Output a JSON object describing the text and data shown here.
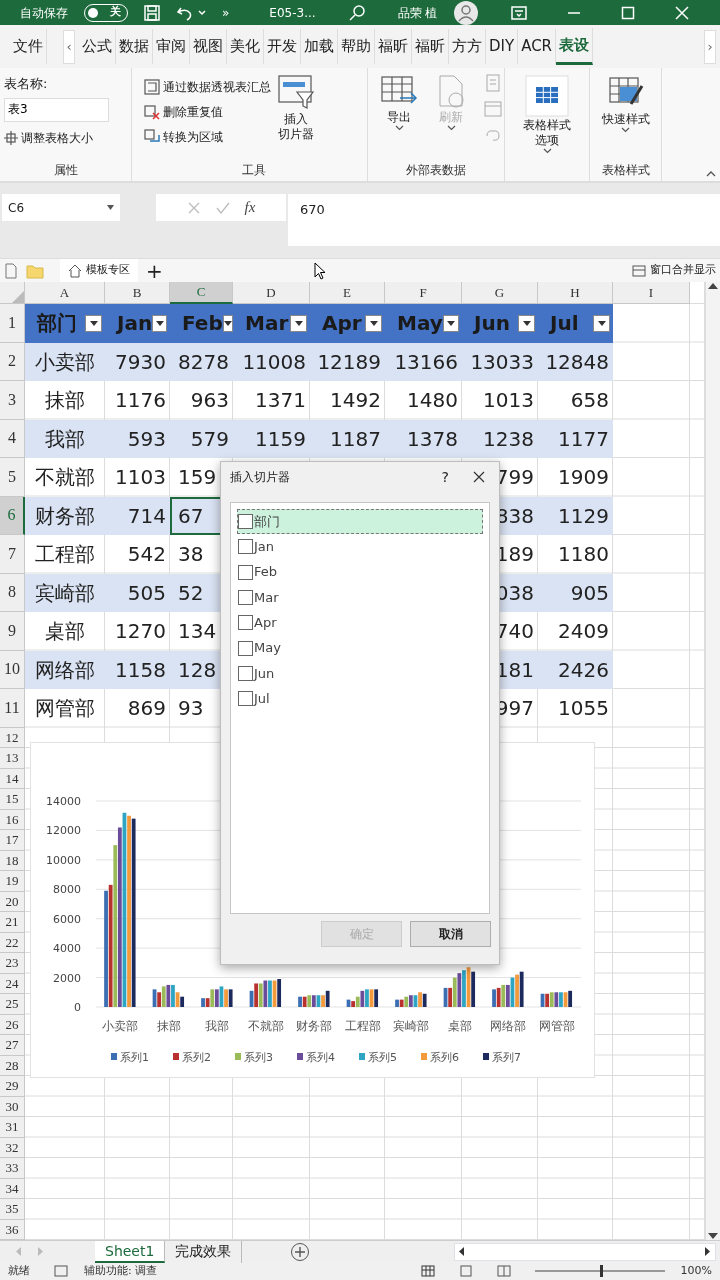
{
  "title_bar": {
    "autosave_label": "自动保存",
    "autosave_toggle": {
      "label": "关",
      "on": false
    },
    "overflow": "»",
    "file_name": "E05-3...",
    "user_name": "品荣 植"
  },
  "ribbon_tabs": {
    "scroll_left": "‹",
    "scroll_right": "›",
    "items": [
      {
        "label": "文件",
        "selected": false
      },
      {
        "label": "公式",
        "selected": false
      },
      {
        "label": "数据",
        "selected": false
      },
      {
        "label": "审阅",
        "selected": false
      },
      {
        "label": "视图",
        "selected": false
      },
      {
        "label": "美化",
        "selected": false
      },
      {
        "label": "开发",
        "selected": false
      },
      {
        "label": "加载",
        "selected": false
      },
      {
        "label": "帮助",
        "selected": false
      },
      {
        "label": "福昕",
        "selected": false
      },
      {
        "label": "福昕",
        "selected": false
      },
      {
        "label": "方方",
        "selected": false
      },
      {
        "label": "DIY",
        "selected": false
      },
      {
        "label": "ACR",
        "selected": false
      },
      {
        "label": "表设",
        "selected": true
      }
    ]
  },
  "ribbon_groups": [
    {
      "kind": "properties",
      "label": "属性",
      "name_label": "表名称:",
      "name_value": "表3",
      "resize_button": "调整表格大小"
    },
    {
      "kind": "tools",
      "label": "工具",
      "actions": [
        "通过数据透视表汇总",
        "删除重复值",
        "转换为区域"
      ],
      "slicer_button": [
        "插入",
        "切片器"
      ]
    },
    {
      "kind": "external",
      "label": "外部表数据",
      "export_button": "导出",
      "refresh_button": {
        "label": "刷新",
        "disabled": true
      }
    },
    {
      "kind": "options",
      "button": [
        "表格样式",
        "选项"
      ]
    },
    {
      "kind": "styles",
      "label": "表格样式",
      "button": "快速样式"
    }
  ],
  "formula_bar": {
    "name_box": "C6",
    "fx_label": "fx",
    "formula": "670"
  },
  "workbook_bar": {
    "home_tab": "模板专区",
    "add": "+",
    "merge_windows": "窗口合并显示"
  },
  "sheet": {
    "columns": [
      {
        "label": "A",
        "selected": false
      },
      {
        "label": "B",
        "selected": false
      },
      {
        "label": "C",
        "selected": true
      },
      {
        "label": "D",
        "selected": false
      },
      {
        "label": "E",
        "selected": false
      },
      {
        "label": "F",
        "selected": false
      },
      {
        "label": "G",
        "selected": false
      },
      {
        "label": "H",
        "selected": false
      },
      {
        "label": "I",
        "selected": false
      }
    ],
    "rows": [
      {
        "number": "1",
        "kind": "table_header",
        "selected": false,
        "cells": [
          "部门",
          "Jan",
          "Feb",
          "Mar",
          "Apr",
          "May",
          "Jun",
          "Jul"
        ]
      },
      {
        "number": "2",
        "kind": "table_row",
        "selected": false,
        "cells": [
          "小卖部",
          "7930",
          "8278",
          "11008",
          "12189",
          "13166",
          "13033",
          "12848"
        ]
      },
      {
        "number": "3",
        "kind": "table_row",
        "selected": false,
        "cells": [
          "抹部",
          "1176",
          "963",
          "1371",
          "1492",
          "1480",
          "1013",
          "658"
        ]
      },
      {
        "number": "4",
        "kind": "table_row",
        "selected": false,
        "cells": [
          "我部",
          "593",
          "579",
          "1159",
          "1187",
          "1378",
          "1238",
          "1177"
        ]
      },
      {
        "number": "5",
        "kind": "table_row",
        "selected": false,
        "cells": [
          "不就部",
          "1103",
          "159"
        ],
        "right_cells": [
          "799",
          "1909"
        ]
      },
      {
        "number": "6",
        "kind": "table_row",
        "selected": true,
        "cells": [
          "财务部",
          "714",
          "67"
        ],
        "right_cells": [
          "838",
          "1129"
        ]
      },
      {
        "number": "7",
        "kind": "table_row",
        "selected": false,
        "cells": [
          "工程部",
          "542",
          "38"
        ],
        "right_cells": [
          "189",
          "1180"
        ]
      },
      {
        "number": "8",
        "kind": "table_row",
        "selected": false,
        "cells": [
          "宾崎部",
          "505",
          "52"
        ],
        "right_cells": [
          "038",
          "905"
        ]
      },
      {
        "number": "9",
        "kind": "table_row",
        "selected": false,
        "cells": [
          "桌部",
          "1270",
          "134"
        ],
        "right_cells": [
          "740",
          "2409"
        ]
      },
      {
        "number": "10",
        "kind": "table_row",
        "selected": false,
        "cells": [
          "网络部",
          "1158",
          "128"
        ],
        "right_cells": [
          "181",
          "2426"
        ]
      },
      {
        "number": "11",
        "kind": "table_row",
        "selected": false,
        "cells": [
          "网管部",
          "869",
          "93"
        ],
        "right_cells": [
          "997",
          "1055"
        ]
      },
      {
        "number": "12",
        "kind": "blank",
        "selected": false
      },
      {
        "number": "13",
        "kind": "blank",
        "selected": false
      },
      {
        "number": "14",
        "kind": "blank",
        "selected": false
      },
      {
        "number": "15",
        "kind": "blank",
        "selected": false
      },
      {
        "number": "16",
        "kind": "blank",
        "selected": false
      },
      {
        "number": "17",
        "kind": "blank",
        "selected": false
      },
      {
        "number": "18",
        "kind": "blank",
        "selected": false
      },
      {
        "number": "19",
        "kind": "blank",
        "selected": false
      },
      {
        "number": "20",
        "kind": "blank",
        "selected": false
      },
      {
        "number": "21",
        "kind": "blank",
        "selected": false
      },
      {
        "number": "22",
        "kind": "blank",
        "selected": false
      },
      {
        "number": "23",
        "kind": "blank",
        "selected": false
      },
      {
        "number": "24",
        "kind": "blank",
        "selected": false
      },
      {
        "number": "25",
        "kind": "blank",
        "selected": false
      },
      {
        "number": "26",
        "kind": "blank",
        "selected": false
      },
      {
        "number": "27",
        "kind": "blank",
        "selected": false
      },
      {
        "number": "28",
        "kind": "blank",
        "selected": false
      },
      {
        "number": "29",
        "kind": "blank",
        "selected": false
      },
      {
        "number": "30",
        "kind": "blank",
        "selected": false
      },
      {
        "number": "31",
        "kind": "blank",
        "selected": false
      },
      {
        "number": "32",
        "kind": "blank",
        "selected": false
      },
      {
        "number": "33",
        "kind": "blank",
        "selected": false
      },
      {
        "number": "34",
        "kind": "blank",
        "selected": false
      },
      {
        "number": "35",
        "kind": "blank",
        "selected": false
      },
      {
        "number": "36",
        "kind": "blank",
        "selected": false
      }
    ]
  },
  "chart": {
    "chart_data": {
      "type": "bar",
      "categories": [
        "小卖部",
        "抹部",
        "我部",
        "不就部",
        "财务部",
        "工程部",
        "宾崎部",
        "桌部",
        "网络部",
        "网管部"
      ],
      "ylim": [
        0,
        14000
      ],
      "yticks": [
        0,
        2000,
        4000,
        6000,
        8000,
        10000,
        12000,
        14000
      ],
      "grid": true,
      "legend": "bottom",
      "series": [
        {
          "name": "系列1",
          "color": "#3c6eb4",
          "values": [
            7900,
            1200,
            600,
            1100,
            700,
            500,
            500,
            1300,
            1200,
            900
          ]
        },
        {
          "name": "系列2",
          "color": "#b8312f",
          "values": [
            8300,
            1000,
            600,
            1600,
            700,
            400,
            500,
            1300,
            1300,
            900
          ]
        },
        {
          "name": "系列3",
          "color": "#9bbb59",
          "values": [
            11000,
            1400,
            1200,
            1600,
            800,
            700,
            700,
            2000,
            1500,
            1000
          ]
        },
        {
          "name": "系列4",
          "color": "#6b4c9a",
          "values": [
            12200,
            1500,
            1200,
            1800,
            800,
            1100,
            800,
            2300,
            1500,
            1000
          ]
        },
        {
          "name": "系列5",
          "color": "#2fa5c4",
          "values": [
            13200,
            1500,
            1400,
            1800,
            800,
            1200,
            800,
            2500,
            2000,
            1000
          ]
        },
        {
          "name": "系列6",
          "color": "#f39a3d",
          "values": [
            13000,
            1000,
            1200,
            1800,
            800,
            1200,
            1000,
            2700,
            2200,
            1000
          ]
        },
        {
          "name": "系列7",
          "color": "#1c2a5e",
          "values": [
            12800,
            700,
            1200,
            1900,
            1100,
            1200,
            900,
            2400,
            2400,
            1100
          ]
        }
      ]
    }
  },
  "dialog": {
    "title": "插入切片器",
    "help": "?",
    "fields": [
      {
        "label": "部门",
        "checked": false,
        "selected": true
      },
      {
        "label": "Jan",
        "checked": false,
        "selected": false
      },
      {
        "label": "Feb",
        "checked": false,
        "selected": false
      },
      {
        "label": "Mar",
        "checked": false,
        "selected": false
      },
      {
        "label": "Apr",
        "checked": false,
        "selected": false
      },
      {
        "label": "May",
        "checked": false,
        "selected": false
      },
      {
        "label": "Jun",
        "checked": false,
        "selected": false
      },
      {
        "label": "Jul",
        "checked": false,
        "selected": false
      }
    ],
    "ok_button": {
      "label": "确定",
      "disabled": true
    },
    "cancel_button": {
      "label": "取消",
      "disabled": false
    }
  },
  "sheet_tabs": {
    "items": [
      {
        "label": "Sheet1",
        "selected": true
      },
      {
        "label": "完成效果",
        "selected": false
      }
    ]
  },
  "status_bar": {
    "ready": "就绪",
    "accessibility": "辅助功能: 调查",
    "zoom_slider": {
      "level": 0.5
    },
    "zoom": "100%"
  }
}
